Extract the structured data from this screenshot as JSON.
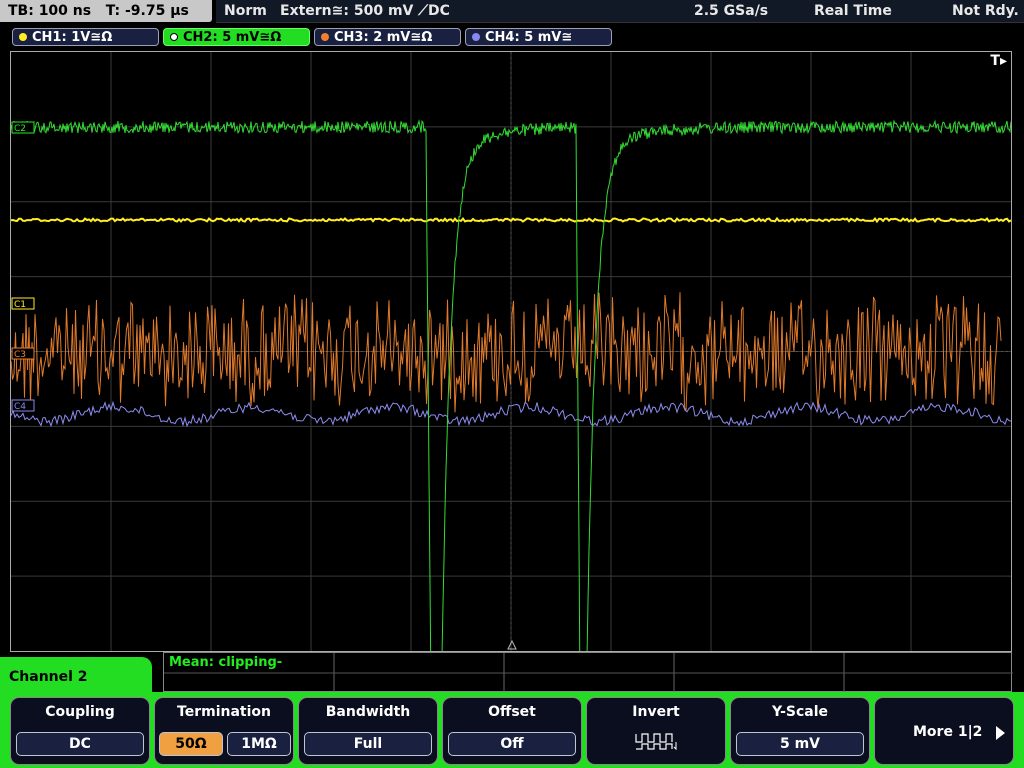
{
  "top_bar": {
    "timebase": "TB: 100 ns   T: -9.75 µs",
    "trigger_mode": "Norm",
    "trigger_source": "Extern≅: 500 mV ⟋DC",
    "sample_rate": "2.5 GSa/s",
    "acq_mode": "Real Time",
    "status": "Not Rdy."
  },
  "channels": [
    {
      "label": "CH1: 1V≅Ω",
      "color": "#ffee22"
    },
    {
      "label": "CH2: 5 mV≅Ω",
      "color": "#22ee22"
    },
    {
      "label": "CH3: 2 mV≅Ω",
      "color": "#f08030"
    },
    {
      "label": "CH4: 5 mV≅",
      "color": "#8888ee"
    }
  ],
  "screen": {
    "trigger_marker": "T▸",
    "channel_markers": {
      "ch1": "C1",
      "ch3": "C3",
      "ch4": "C4",
      "ch2": "C2"
    }
  },
  "measurement": {
    "text": "Mean: clipping-"
  },
  "menu": {
    "title": "Channel 2",
    "coupling": {
      "title": "Coupling",
      "value": "DC"
    },
    "termination": {
      "title": "Termination",
      "opt1": "50Ω",
      "opt2": "1MΩ"
    },
    "bandwidth": {
      "title": "Bandwidth",
      "value": "Full"
    },
    "offset": {
      "title": "Offset",
      "value": "Off"
    },
    "invert": {
      "title": "Invert"
    },
    "yscale": {
      "title": "Y-Scale",
      "value": "5 mV"
    },
    "more": {
      "label": "More 1|2"
    }
  }
}
